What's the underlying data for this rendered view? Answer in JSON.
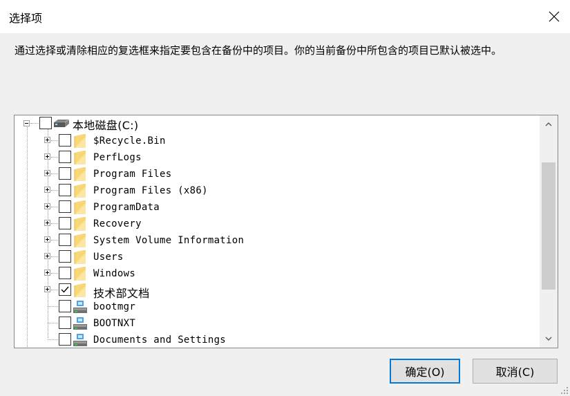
{
  "dialog": {
    "title": "选择项",
    "instruction": "通过选择或清除相应的复选框来指定要包含在备份中的项目。你的当前备份中所包含的项目已默认被选中。"
  },
  "tree": {
    "root": {
      "label": "本地磁盘(C:)",
      "checked": false,
      "expanded": true,
      "icon": "drive-icon"
    },
    "items": [
      {
        "label": "$Recycle.Bin",
        "type": "folder",
        "checked": false
      },
      {
        "label": "PerfLogs",
        "type": "folder",
        "checked": false
      },
      {
        "label": "Program Files",
        "type": "folder",
        "checked": false
      },
      {
        "label": "Program Files (x86)",
        "type": "folder",
        "checked": false
      },
      {
        "label": "ProgramData",
        "type": "folder",
        "checked": false
      },
      {
        "label": "Recovery",
        "type": "folder",
        "checked": false
      },
      {
        "label": "System Volume Information",
        "type": "folder",
        "checked": false
      },
      {
        "label": "Users",
        "type": "folder",
        "checked": false
      },
      {
        "label": "Windows",
        "type": "folder",
        "checked": false
      },
      {
        "label": "技术部文档",
        "type": "folder",
        "checked": true
      },
      {
        "label": "bootmgr",
        "type": "file",
        "checked": false
      },
      {
        "label": "BOOTNXT",
        "type": "file",
        "checked": false
      },
      {
        "label": "Documents and Settings",
        "type": "file",
        "checked": false
      }
    ]
  },
  "buttons": {
    "ok": "确定(O)",
    "cancel": "取消(C)"
  },
  "colors": {
    "accent": "#0078d7",
    "folder": "#f8d775"
  }
}
